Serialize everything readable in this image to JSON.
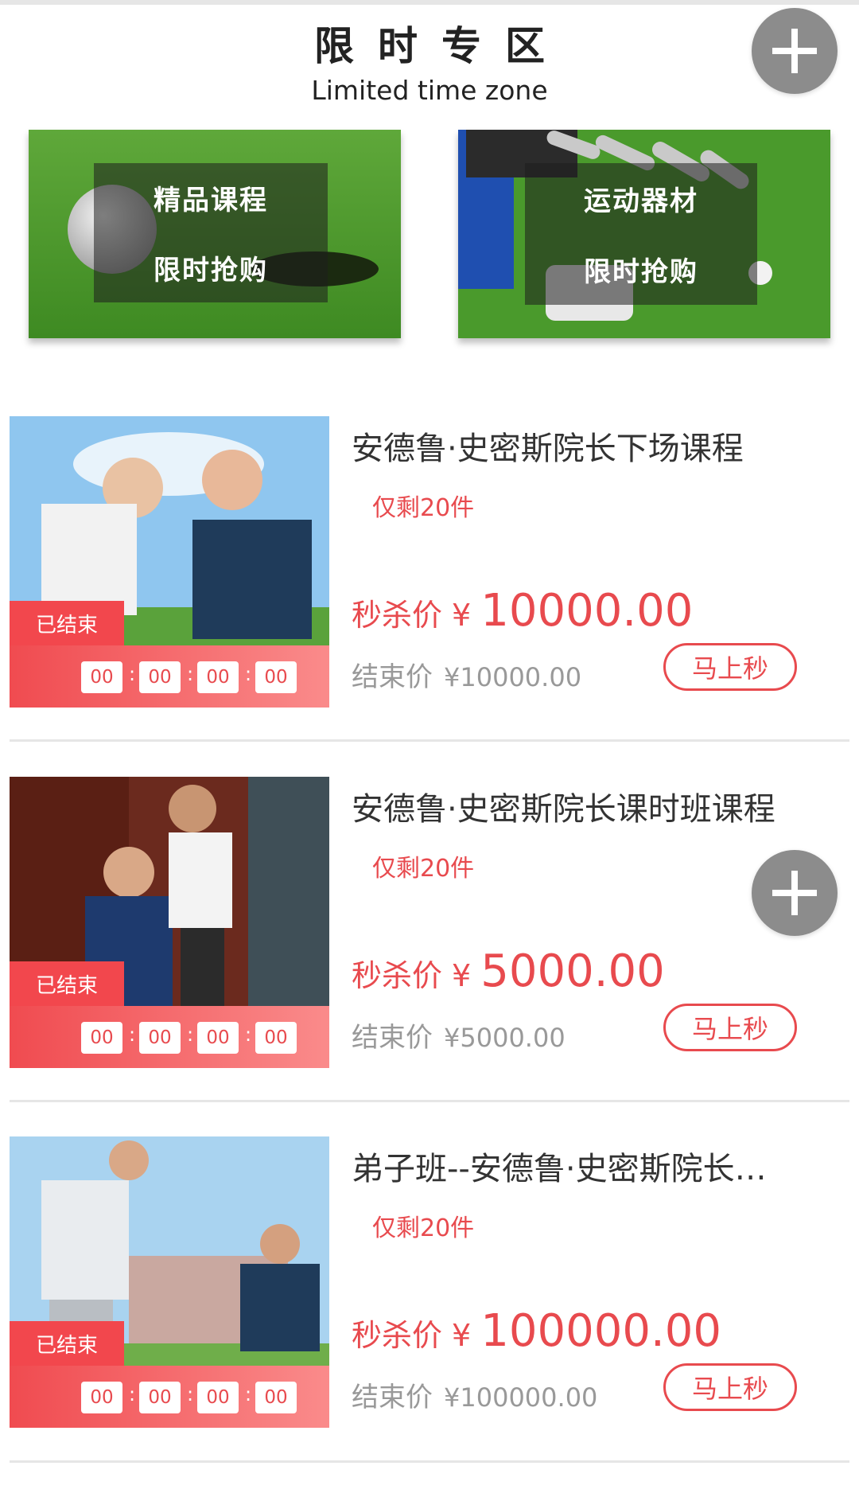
{
  "header": {
    "title_cn": "限时专区",
    "title_en": "Limited time zone"
  },
  "fab_icon": "plus-icon",
  "banners": [
    {
      "line1": "精品课程",
      "line2": "限时抢购"
    },
    {
      "line1": "运动器材",
      "line2": "限时抢购"
    }
  ],
  "products": [
    {
      "name": "安德鲁·史密斯院长下场课程",
      "stock": "仅剩20件",
      "price_label": "秒杀价",
      "currency": "¥",
      "price": "10000.00",
      "end_label": "结束价",
      "end_price": "¥10000.00",
      "ended": "已结束",
      "timer": [
        "00",
        "00",
        "00",
        "00"
      ],
      "timer_sep": ":",
      "buy": "马上秒"
    },
    {
      "name": "安德鲁·史密斯院长课时班课程",
      "stock": "仅剩20件",
      "price_label": "秒杀价",
      "currency": "¥",
      "price": "5000.00",
      "end_label": "结束价",
      "end_price": "¥5000.00",
      "ended": "已结束",
      "timer": [
        "00",
        "00",
        "00",
        "00"
      ],
      "timer_sep": ":",
      "buy": "马上秒"
    },
    {
      "name": "弟子班--安德鲁·史密斯院长课程",
      "stock": "仅剩20件",
      "price_label": "秒杀价",
      "currency": "¥",
      "price": "100000.00",
      "end_label": "结束价",
      "end_price": "¥100000.00",
      "ended": "已结束",
      "timer": [
        "00",
        "00",
        "00",
        "00"
      ],
      "timer_sep": ":",
      "buy": "马上秒"
    }
  ],
  "colors": {
    "accent": "#e84a4e",
    "fab": "#8c8c8c",
    "divider": "#e6e6e6"
  }
}
